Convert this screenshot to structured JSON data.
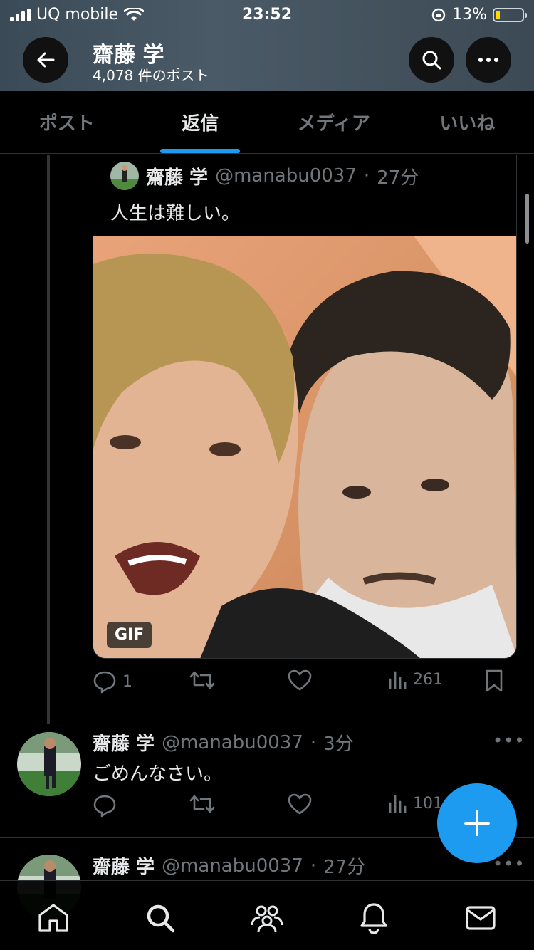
{
  "status_bar": {
    "carrier": "UQ mobile",
    "time": "23:52",
    "battery": "13%"
  },
  "header": {
    "title": "齋藤 学",
    "subtitle": "4,078 件のポスト"
  },
  "tabs": [
    {
      "label": "ポスト",
      "active": false
    },
    {
      "label": "返信",
      "active": true
    },
    {
      "label": "メディア",
      "active": false
    },
    {
      "label": "いいね",
      "active": false
    }
  ],
  "quoted_post": {
    "name": "齋藤 学",
    "handle": "@manabu0037",
    "separator": "·",
    "time": "27分",
    "text": "人生は難しい。",
    "media_badge": "GIF",
    "replies": "1",
    "views": "261"
  },
  "replies": [
    {
      "name": "齋藤 学",
      "handle": "@manabu0037",
      "separator": "·",
      "time": "3分",
      "text": "ごめんなさい。",
      "views": "101"
    },
    {
      "name": "齋藤 学",
      "handle": "@manabu0037",
      "separator": "·",
      "time": "27分"
    }
  ],
  "colors": {
    "accent": "#1d9bf0",
    "background": "#000000",
    "muted": "#71767b"
  },
  "bottom_nav": [
    "home-icon",
    "search-icon",
    "communities-icon",
    "notifications-icon",
    "messages-icon"
  ]
}
